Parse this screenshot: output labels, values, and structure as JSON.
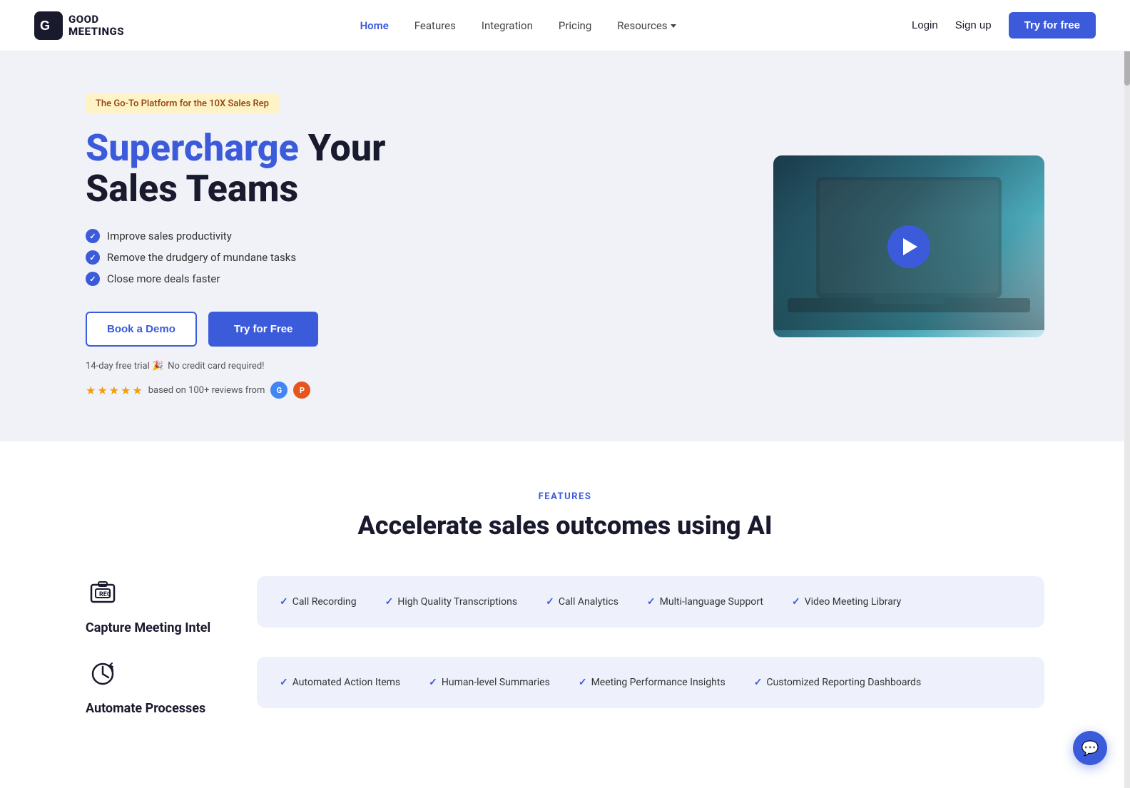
{
  "header": {
    "logo_line1": "GOOD",
    "logo_line2": "MEETINGS",
    "nav": [
      {
        "label": "Home",
        "active": true
      },
      {
        "label": "Features",
        "active": false
      },
      {
        "label": "Integration",
        "active": false
      },
      {
        "label": "Pricing",
        "active": false
      },
      {
        "label": "Resources",
        "active": false,
        "has_dropdown": true
      }
    ],
    "login_label": "Login",
    "signup_label": "Sign up",
    "try_free_label": "Try for free"
  },
  "hero": {
    "badge": "The Go-To Platform for the 10X Sales Rep",
    "title_accent": "Supercharge",
    "title_rest": " Your\nSales Teams",
    "checks": [
      "Improve sales productivity",
      "Remove the drudgery of mundane tasks",
      "Close more deals faster"
    ],
    "btn_demo": "Book a Demo",
    "btn_try": "Try for Free",
    "trial_note": "14-day free trial 🎉",
    "no_cc": "No credit card required!",
    "review_text": "based on 100+ reviews from",
    "stars_count": 5
  },
  "features": {
    "section_label": "FEATURES",
    "section_title": "Accelerate sales outcomes using AI",
    "items": [
      {
        "name": "Capture Meeting Intel",
        "icon": "camera-box",
        "tags": [
          "Call Recording",
          "High Quality Transcriptions",
          "Call Analytics",
          "Multi-language Support",
          "Video Meeting Library"
        ]
      },
      {
        "name": "Automate Processes",
        "icon": "clock-refresh",
        "tags": [
          "Automated Action Items",
          "Human-level Summaries",
          "Meeting Performance Insights",
          "Customized Reporting Dashboards"
        ]
      }
    ]
  },
  "chat": {
    "icon": "💬"
  },
  "colors": {
    "primary": "#3b5bdb",
    "badge_bg": "#fef3c7",
    "hero_bg": "#f0f2f8",
    "card_bg": "#eef1fb"
  }
}
